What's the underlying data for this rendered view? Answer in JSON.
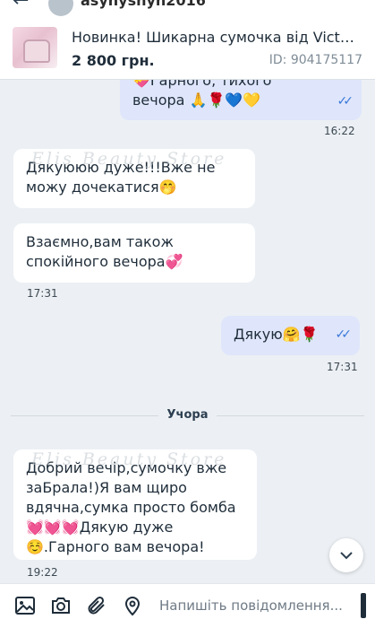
{
  "header": {
    "back_icon": "arrow-left-icon",
    "username": "asynysnyn2016"
  },
  "product": {
    "title": "Новинка! Шикарна сумочка від Victoria's...",
    "price": "2 800 грн.",
    "id": "ID: 904175117"
  },
  "messages": [
    {
      "dir": "out",
      "text": "💝Гарного, тихого вечора 🙏🌹💙💛",
      "time": "16:22",
      "read": true
    },
    {
      "dir": "in",
      "text": "Дякуююю дуже!!!Вже не можу дочекатися🤭"
    },
    {
      "dir": "in",
      "text": "Взаємно,вам також спокійного вечора💞",
      "time": "17:31"
    },
    {
      "dir": "out",
      "text": "Дякую🤗🌹",
      "time": "17:31",
      "read": true
    },
    {
      "dir": "in",
      "text": "Добрий вечір,сумочку вже заБрала!)Я вам щиро вдячна,сумка просто бомба💓💓💓Дякую дуже☺️.Гарного вам вечора!",
      "time": "19:22"
    }
  ],
  "day_separator": "Учора",
  "watermark": "Elis Beauty Store",
  "composer": {
    "placeholder": "Напишіть повідомлення..."
  },
  "colors": {
    "outgoing_bubble": "#dfe6fb",
    "incoming_bubble": "#ffffff",
    "read_ticks": "#3a77d9",
    "background": "#ecf0f4"
  }
}
